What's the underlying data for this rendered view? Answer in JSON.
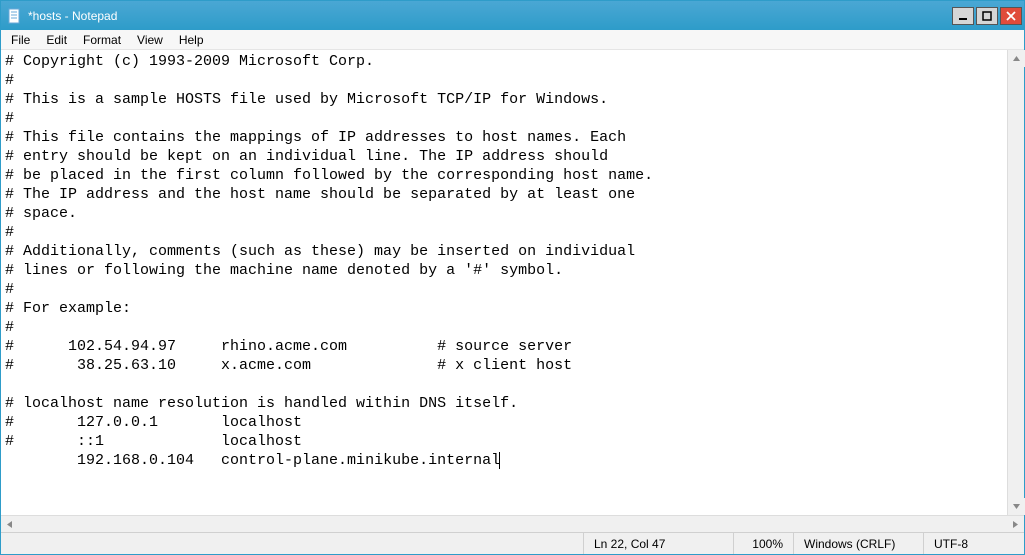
{
  "window": {
    "title": "*hosts - Notepad"
  },
  "menu": {
    "items": [
      "File",
      "Edit",
      "Format",
      "View",
      "Help"
    ]
  },
  "editor": {
    "content": "# Copyright (c) 1993-2009 Microsoft Corp.\n#\n# This is a sample HOSTS file used by Microsoft TCP/IP for Windows.\n#\n# This file contains the mappings of IP addresses to host names. Each\n# entry should be kept on an individual line. The IP address should\n# be placed in the first column followed by the corresponding host name.\n# The IP address and the host name should be separated by at least one\n# space.\n#\n# Additionally, comments (such as these) may be inserted on individual\n# lines or following the machine name denoted by a '#' symbol.\n#\n# For example:\n#\n#      102.54.94.97     rhino.acme.com          # source server\n#       38.25.63.10     x.acme.com              # x client host\n\n# localhost name resolution is handled within DNS itself.\n#\t127.0.0.1       localhost\n#\t::1             localhost\n\t192.168.0.104   control-plane.minikube.internal"
  },
  "status": {
    "lncol": "Ln 22, Col 47",
    "zoom": "100%",
    "eol": "Windows (CRLF)",
    "encoding": "UTF-8"
  }
}
